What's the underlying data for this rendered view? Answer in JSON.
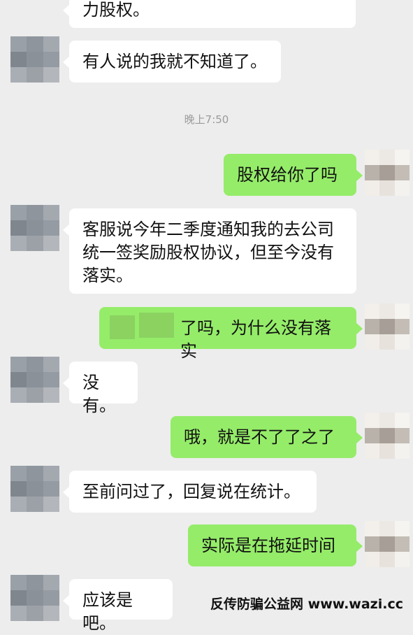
{
  "chat": {
    "timestamp": "晚上7:50",
    "messages": [
      {
        "side": "left",
        "text": "力股权。"
      },
      {
        "side": "left",
        "text": "有人说的我就不知道了。"
      },
      {
        "side": "right",
        "text": "股权给你了吗"
      },
      {
        "side": "left",
        "text": "客服说今年二季度通知我的去公司统一签奖励股权协议，但至今没有落实。"
      },
      {
        "side": "right",
        "text": "了吗，为什么没有落实"
      },
      {
        "side": "left",
        "text": "没有。"
      },
      {
        "side": "right",
        "text": "哦，就是不了了之了"
      },
      {
        "side": "left",
        "text": "至前问过了，回复说在统计。"
      },
      {
        "side": "right",
        "text": "实际是在拖延时间"
      },
      {
        "side": "left",
        "text": "应该是吧。"
      }
    ]
  },
  "watermark": "反传防骗公益网 www.wazi.cc",
  "colors": {
    "background": "#ededed",
    "left_bubble": "#ffffff",
    "right_bubble": "#95ec69",
    "timestamp": "#9b9b9b"
  }
}
